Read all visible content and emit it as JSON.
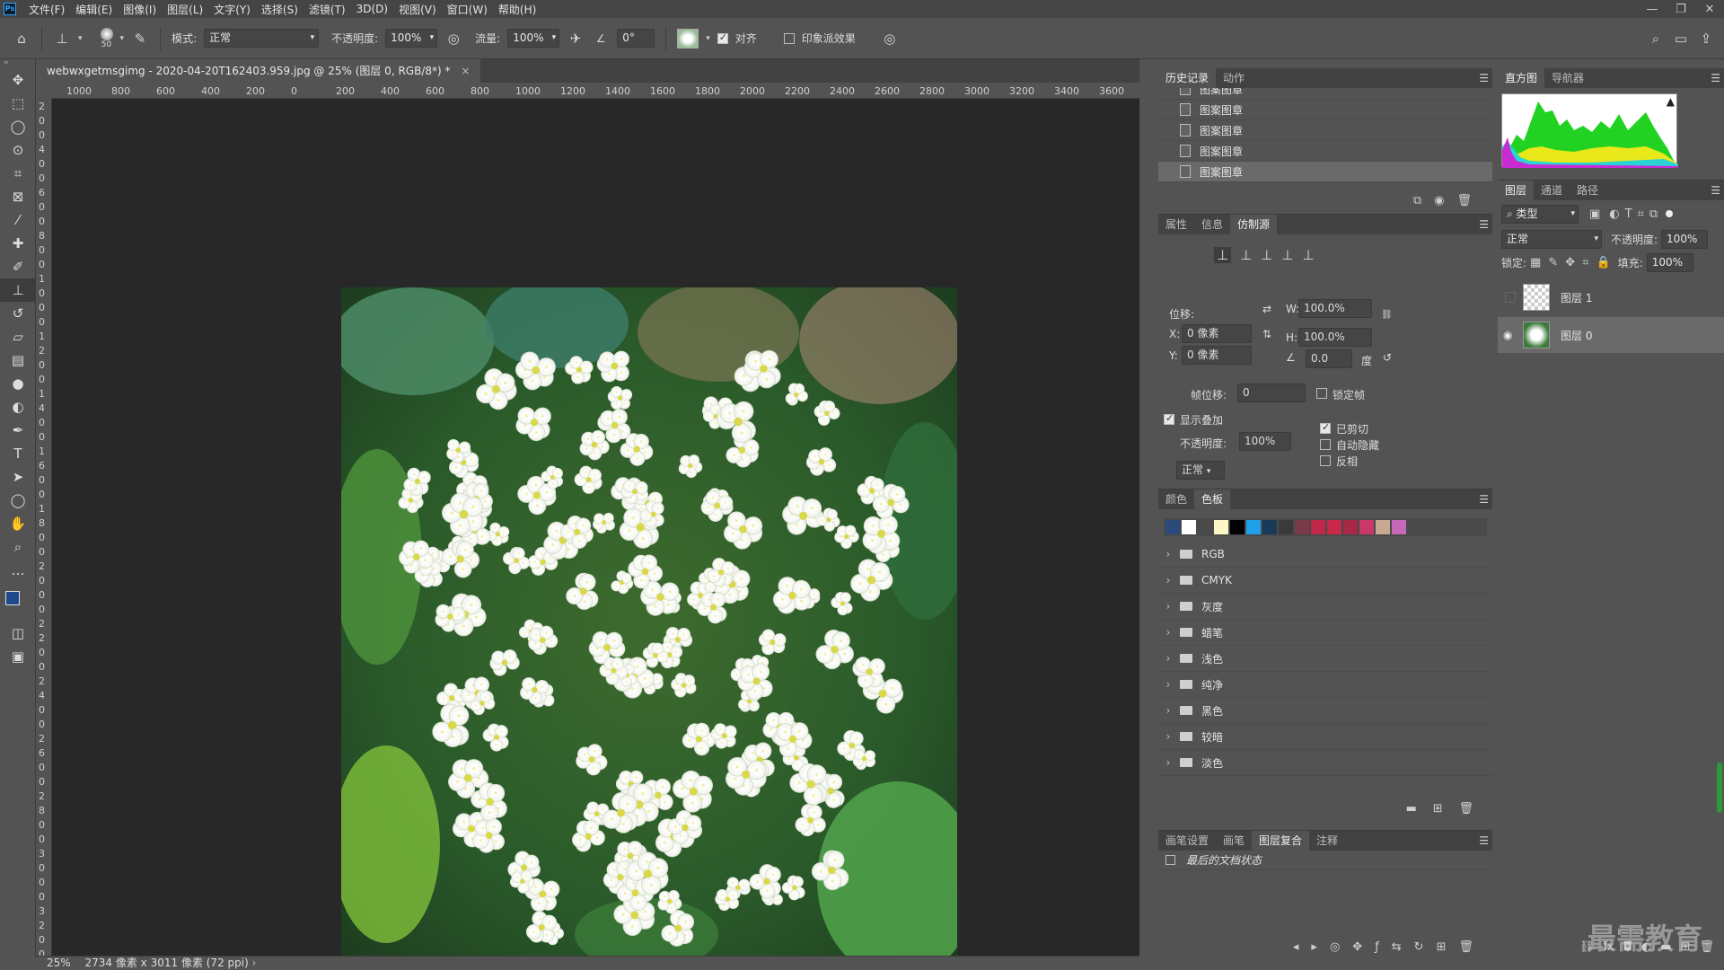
{
  "menubar": {
    "logo": "Ps",
    "items": [
      "文件(F)",
      "编辑(E)",
      "图像(I)",
      "图层(L)",
      "文字(Y)",
      "选择(S)",
      "滤镜(T)",
      "3D(D)",
      "视图(V)",
      "窗口(W)",
      "帮助(H)"
    ],
    "window_buttons": [
      "—",
      "❐",
      "✕"
    ]
  },
  "options": {
    "brush_size": "50",
    "mode_label": "模式:",
    "mode_value": "正常",
    "opacity_label": "不透明度:",
    "opacity_value": "100%",
    "flow_label": "流量:",
    "flow_value": "100%",
    "angle_value": "0°",
    "aligned_label": "对齐",
    "aligned_checked": true,
    "impressionist_label": "印象派效果",
    "impressionist_checked": false
  },
  "document": {
    "tab_title": "webwxgetmsgimg - 2020-04-20T162403.959.jpg @ 25% (图层 0, RGB/8*) *",
    "tab_close": "×",
    "ruler_top": [
      "1000",
      "800",
      "600",
      "400",
      "200",
      "0",
      "200",
      "400",
      "600",
      "800",
      "1000",
      "1200",
      "1400",
      "1600",
      "1800",
      "2000",
      "2200",
      "2400",
      "2600",
      "2800",
      "3000",
      "3200",
      "3400",
      "3600"
    ],
    "ruler_left": [
      "2",
      "0",
      "0",
      "4",
      "0",
      "0",
      "6",
      "0",
      "0",
      "8",
      "0",
      "0",
      "1",
      "0",
      "0",
      "0",
      "1",
      "2",
      "0",
      "0",
      "1",
      "4",
      "0",
      "0",
      "1",
      "6",
      "0",
      "0",
      "1",
      "8",
      "0",
      "0",
      "2",
      "0",
      "0",
      "0",
      "2",
      "2",
      "0",
      "0",
      "2",
      "4",
      "0",
      "0",
      "2",
      "6",
      "0",
      "0",
      "2",
      "8",
      "0",
      "0",
      "3",
      "0",
      "0",
      "0",
      "3",
      "2",
      "0",
      "0"
    ]
  },
  "status": {
    "zoom": "25%",
    "info": "2734 像素 x 3011 像素 (72 ppi)"
  },
  "history_panel": {
    "tabs": [
      "历史记录",
      "动作"
    ],
    "rows": [
      "图案图章",
      "图案图章",
      "图案图章",
      "图案图章",
      "图案图章"
    ]
  },
  "clone_panel": {
    "tabs": [
      "属性",
      "信息",
      "仿制源"
    ],
    "offset_label": "位移:",
    "w_label": "W:",
    "w_value": "100.0%",
    "h_label": "H:",
    "h_value": "100.0%",
    "x_label": "X:",
    "x_value": "0 像素",
    "y_label": "Y:",
    "y_value": "0 像素",
    "angle_value": "0.0",
    "angle_unit": "度",
    "frame_offset_label": "帧位移:",
    "frame_offset_value": "0",
    "lock_frame_label": "锁定帧",
    "show_overlay_label": "显示叠加",
    "clipped_label": "已剪切",
    "auto_hide_label": "自动隐藏",
    "invert_label": "反相",
    "overlay_opacity_label": "不透明度:",
    "overlay_opacity_value": "100%",
    "overlay_mode": "正常"
  },
  "swatches_panel": {
    "tabs": [
      "颜色",
      "色板"
    ],
    "colors": [
      "#2a4a7a",
      "#ffffff",
      "#4a4a4a",
      "#fff6c8",
      "#000000",
      "#1ea0ea",
      "#1a3a5a",
      "#3a3a3a",
      "#7a3a4a",
      "#c0284a",
      "#c8284a",
      "#a82848",
      "#c83868",
      "#c8a890",
      "#c868b8"
    ],
    "folders": [
      "RGB",
      "CMYK",
      "灰度",
      "蜡笔",
      "浅色",
      "纯净",
      "黑色",
      "较暗",
      "淡色"
    ]
  },
  "bottom_panel": {
    "tabs": [
      "画笔设置",
      "画笔",
      "图层复合",
      "注释"
    ],
    "item": "最后的文档状态"
  },
  "histogram_panel": {
    "tabs": [
      "直方图",
      "导航器"
    ],
    "warning": "▲"
  },
  "layers_panel": {
    "tabs": [
      "图层",
      "通道",
      "路径"
    ],
    "filter_label": "类型",
    "blend_mode": "正常",
    "opacity_label": "不透明度:",
    "opacity_value": "100%",
    "lock_label": "锁定:",
    "fill_label": "填充:",
    "fill_value": "100%",
    "layers": [
      "图层 1",
      "图层 0"
    ]
  },
  "watermark": "最需教育"
}
